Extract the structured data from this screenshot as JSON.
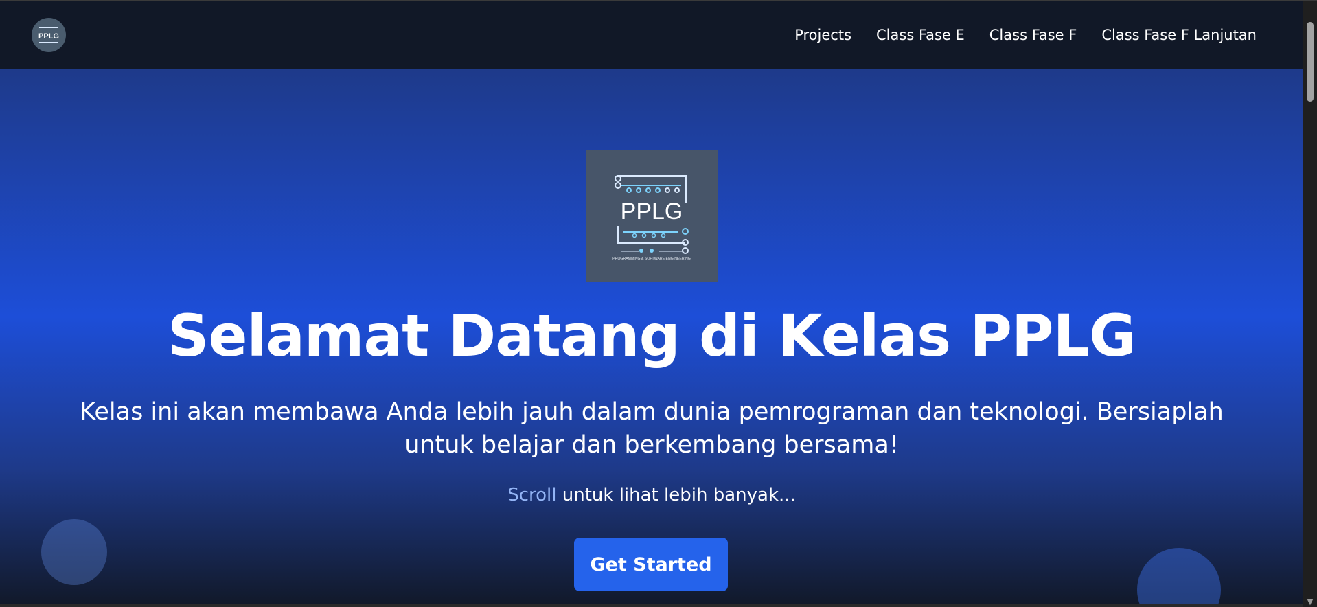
{
  "navbar": {
    "logo_text": "PPLG",
    "links": [
      "Projects",
      "Class Fase E",
      "Class Fase F",
      "Class Fase F Lanjutan"
    ]
  },
  "hero": {
    "logo_text": "PPLG",
    "logo_subtext": "PROGRAMMING & SOFTWARE ENGINEERING",
    "title": "Selamat Datang di Kelas PPLG",
    "subtitle": "Kelas ini akan membawa Anda lebih jauh dalam dunia pemrograman dan teknologi. Bersiaplah untuk belajar dan berkembang bersama!",
    "scroll_highlight": "Scroll",
    "scroll_rest": " untuk lihat lebih banyak...",
    "cta_label": "Get Started"
  },
  "colors": {
    "navbar_bg": "#111827",
    "hero_gradient_mid": "#1d4ed8",
    "cta_bg": "#2563eb",
    "logo_bg": "#475569",
    "circuit_light": "#dbeafe",
    "circuit_blue": "#7dd3fc"
  },
  "icons": {
    "nav_logo": "pplg-circuit-logo-icon",
    "hero_logo": "pplg-circuit-logo-icon",
    "scroll_up": "triangle-up-icon",
    "scroll_down": "triangle-down-icon"
  }
}
